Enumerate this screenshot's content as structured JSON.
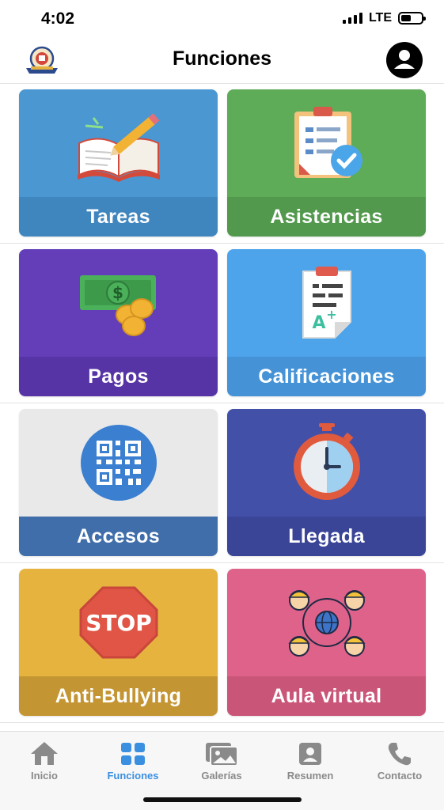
{
  "status_bar": {
    "time": "4:02",
    "network": "LTE",
    "battery_level": 0.5
  },
  "header": {
    "title": "Funciones",
    "logo_icon": "school-crest-icon",
    "profile_icon": "user-profile-icon"
  },
  "cards": [
    {
      "label": "Tareas",
      "icon": "open-book-pencil-icon",
      "color": "#4a97d2",
      "band": "#3f86bf"
    },
    {
      "label": "Asistencias",
      "icon": "clipboard-check-icon",
      "color": "#5eab58",
      "band": "#52994d"
    },
    {
      "label": "Pagos",
      "icon": "money-coins-icon",
      "color": "#643eb8",
      "band": "#5734a5"
    },
    {
      "label": "Calificaciones",
      "icon": "graded-paper-icon",
      "color": "#4ea4ea",
      "band": "#4592d6"
    },
    {
      "label": "Accesos",
      "icon": "qr-code-icon",
      "color": "#e9e9e9",
      "band": "#3f6eaa"
    },
    {
      "label": "Llegada",
      "icon": "stopwatch-icon",
      "color": "#4350a8",
      "band": "#3a4597"
    },
    {
      "label": "Anti-Bullying",
      "icon": "stop-sign-icon",
      "color": "#e6b33f",
      "band": "#c49533"
    },
    {
      "label": "Aula virtual",
      "icon": "global-network-icon",
      "color": "#de6289",
      "band": "#c95679"
    }
  ],
  "stop_text": "STOP",
  "tabs": [
    {
      "label": "Inicio",
      "icon": "home-icon",
      "active": false
    },
    {
      "label": "Funciones",
      "icon": "grid-icon",
      "active": true
    },
    {
      "label": "Galerías",
      "icon": "gallery-icon",
      "active": false
    },
    {
      "label": "Resumen",
      "icon": "summary-icon",
      "active": false
    },
    {
      "label": "Contacto",
      "icon": "phone-icon",
      "active": false
    }
  ],
  "colors": {
    "active_tab": "#3b8fe0",
    "inactive_tab": "#8a8a8a"
  }
}
